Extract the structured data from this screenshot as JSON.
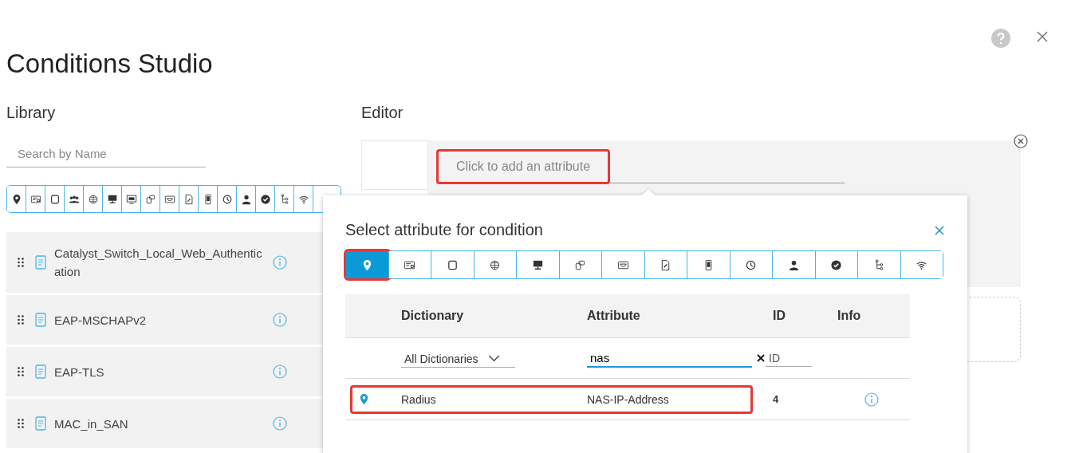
{
  "dialog": {
    "title": "Conditions Studio"
  },
  "library": {
    "heading": "Library",
    "search": {
      "placeholder": "Search by Name"
    },
    "filters": [
      {
        "kind": "pin"
      },
      {
        "kind": "card"
      },
      {
        "kind": "square"
      },
      {
        "kind": "people"
      },
      {
        "kind": "globe"
      },
      {
        "kind": "monitor"
      },
      {
        "kind": "screen"
      },
      {
        "kind": "devices"
      },
      {
        "kind": "tray"
      },
      {
        "kind": "document"
      },
      {
        "kind": "phone"
      },
      {
        "kind": "clock"
      },
      {
        "kind": "person"
      },
      {
        "kind": "check"
      },
      {
        "kind": "hierarchy"
      },
      {
        "kind": "wifi"
      }
    ],
    "items": [
      {
        "name": "Catalyst_Switch_Local_Web_Authentication"
      },
      {
        "name": "EAP-MSCHAPv2"
      },
      {
        "name": "EAP-TLS"
      },
      {
        "name": "MAC_in_SAN"
      }
    ]
  },
  "editor": {
    "heading": "Editor",
    "attribute_field": {
      "placeholder": "Click to add an attribute",
      "highlighted": true
    }
  },
  "popup": {
    "title": "Select attribute for condition",
    "tabs": [
      {
        "kind": "pin",
        "selected": true,
        "highlighted": true
      },
      {
        "kind": "card",
        "selected": false,
        "highlighted": false
      },
      {
        "kind": "square",
        "selected": false,
        "highlighted": false
      },
      {
        "kind": "globe",
        "selected": false,
        "highlighted": false
      },
      {
        "kind": "monitor",
        "selected": false,
        "highlighted": false
      },
      {
        "kind": "devices",
        "selected": false,
        "highlighted": false
      },
      {
        "kind": "tray",
        "selected": false,
        "highlighted": false
      },
      {
        "kind": "document",
        "selected": false,
        "highlighted": false
      },
      {
        "kind": "phone",
        "selected": false,
        "highlighted": false
      },
      {
        "kind": "clock",
        "selected": false,
        "highlighted": false
      },
      {
        "kind": "person",
        "selected": false,
        "highlighted": false
      },
      {
        "kind": "check",
        "selected": false,
        "highlighted": false
      },
      {
        "kind": "hierarchy",
        "selected": false,
        "highlighted": false
      },
      {
        "kind": "wifi",
        "selected": false,
        "highlighted": false
      }
    ],
    "table": {
      "columns": [
        "Dictionary",
        "Attribute",
        "ID",
        "Info"
      ],
      "filters": {
        "dictionary": "All Dictionaries",
        "attribute": "nas",
        "id_placeholder": "ID"
      },
      "rows": [
        {
          "dictionary": "Radius",
          "attribute": "NAS-IP-Address",
          "id": "4",
          "highlighted": true
        }
      ]
    }
  }
}
